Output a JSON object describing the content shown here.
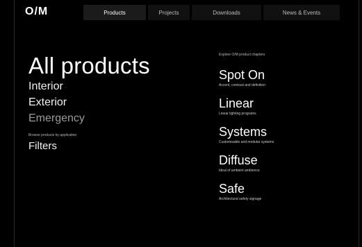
{
  "brand": {
    "logo": "O/M"
  },
  "nav": {
    "tabs": [
      {
        "label": "Products"
      },
      {
        "label": "Projects"
      },
      {
        "label": "Downloads"
      },
      {
        "label": "News & Events"
      }
    ]
  },
  "main": {
    "title": "All products",
    "categories": [
      "Interior",
      "Exterior",
      "Emergency"
    ],
    "browse_text": "Browse products by application",
    "filters_label": "Filters"
  },
  "side": {
    "explore_text": "Explore O/M product chapters",
    "products": [
      {
        "name": "Spot On",
        "desc": "Accent, contrast and definition"
      },
      {
        "name": "Linear",
        "desc": "Linear lighting programs"
      },
      {
        "name": "Systems",
        "desc": "Customisable and modular systems"
      },
      {
        "name": "Diffuse",
        "desc": "Ideal of ambient ambience"
      },
      {
        "name": "Safe",
        "desc": "Architectural safety signage"
      }
    ]
  }
}
